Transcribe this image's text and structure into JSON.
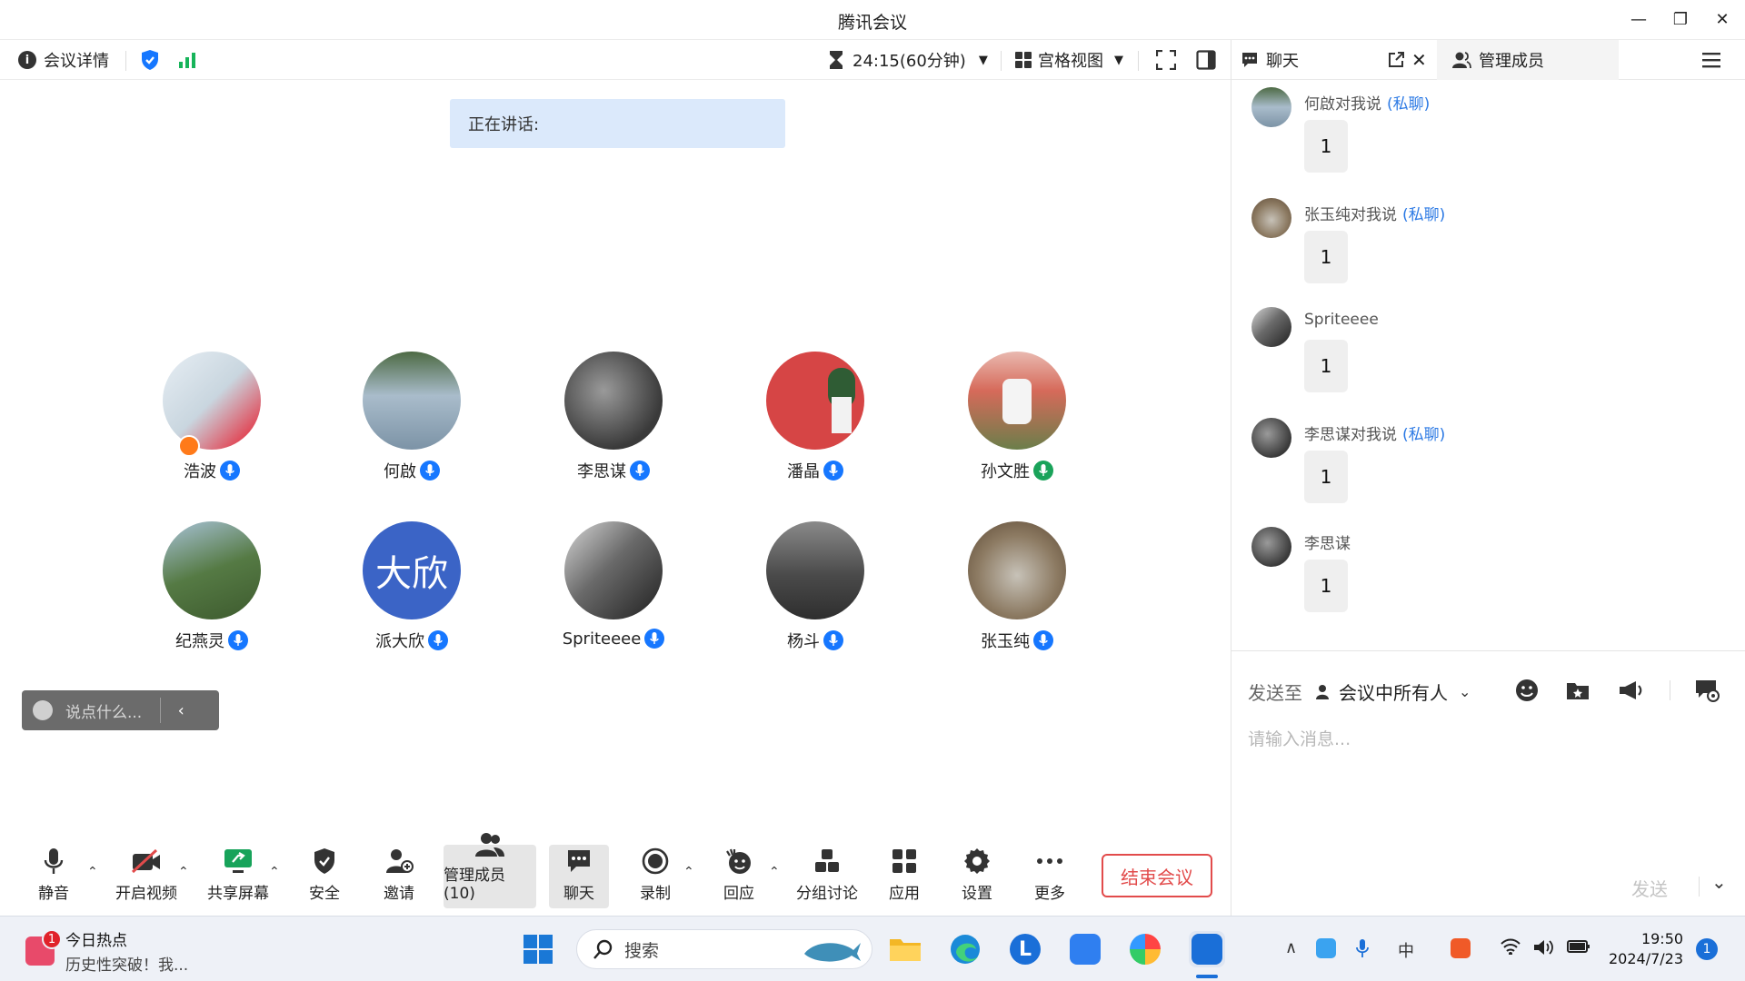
{
  "window": {
    "title": "腾讯会议",
    "minimize": "—",
    "restore": "❐",
    "close": "✕"
  },
  "topbar": {
    "meeting_details": "会议详情",
    "timer": "24:15(60分钟)",
    "grid_view": "宫格视图"
  },
  "speaking_banner": "正在讲话:",
  "participants": [
    {
      "name": "浩波",
      "avatar_color": "#c9d6df"
    },
    {
      "name": "何啟",
      "avatar_color": "#8fa7b8"
    },
    {
      "name": "李思谋",
      "avatar_color": "#4a4a4a"
    },
    {
      "name": "潘晶",
      "avatar_color": "#d64545"
    },
    {
      "name": "孙文胜",
      "avatar_color": "#c98a78"
    },
    {
      "name": "纪燕灵",
      "avatar_color": "#5b7a4a"
    },
    {
      "name": "派大欣",
      "avatar_text": "大欣",
      "avatar_color": "#3b64c6"
    },
    {
      "name": "Spriteeee",
      "avatar_color": "#3d3d3d"
    },
    {
      "name": "杨斗",
      "avatar_color": "#5e5e5e"
    },
    {
      "name": "张玉纯",
      "avatar_color": "#a88c6c"
    }
  ],
  "saybox": {
    "placeholder": "说点什么..."
  },
  "toolbar": {
    "mute": "静音",
    "video": "开启视频",
    "share": "共享屏幕",
    "security": "安全",
    "invite": "邀请",
    "members": "管理成员(10)",
    "chat": "聊天",
    "record": "录制",
    "react": "回应",
    "breakout": "分组讨论",
    "apps": "应用",
    "settings": "设置",
    "more": "更多",
    "end": "结束会议"
  },
  "chat_panel": {
    "tab_chat": "聊天",
    "tab_members": "管理成员",
    "messages": [
      {
        "sender": "何啟对我说",
        "private": "(私聊)",
        "text": "1",
        "avatar_color": "#8fa7b8"
      },
      {
        "sender": "张玉纯对我说",
        "private": "(私聊)",
        "text": "1",
        "avatar_color": "#a88c6c"
      },
      {
        "sender": "Spriteeee",
        "private": "",
        "text": "1",
        "avatar_color": "#3d3d3d"
      },
      {
        "sender": "李思谋对我说",
        "private": "(私聊)",
        "text": "1",
        "avatar_color": "#4a4a4a"
      },
      {
        "sender": "李思谋",
        "private": "",
        "text": "1",
        "avatar_color": "#4a4a4a"
      }
    ],
    "send_to_label": "发送至",
    "send_to_target": "会议中所有人",
    "input_placeholder": "请输入消息...",
    "send_button": "发送"
  },
  "taskbar": {
    "news_title": "今日热点",
    "news_sub": "历史性突破！我...",
    "news_badge": "1",
    "search_label": "搜索",
    "ime": "中",
    "time": "19:50",
    "date": "2024/7/23",
    "notifications": "1"
  }
}
